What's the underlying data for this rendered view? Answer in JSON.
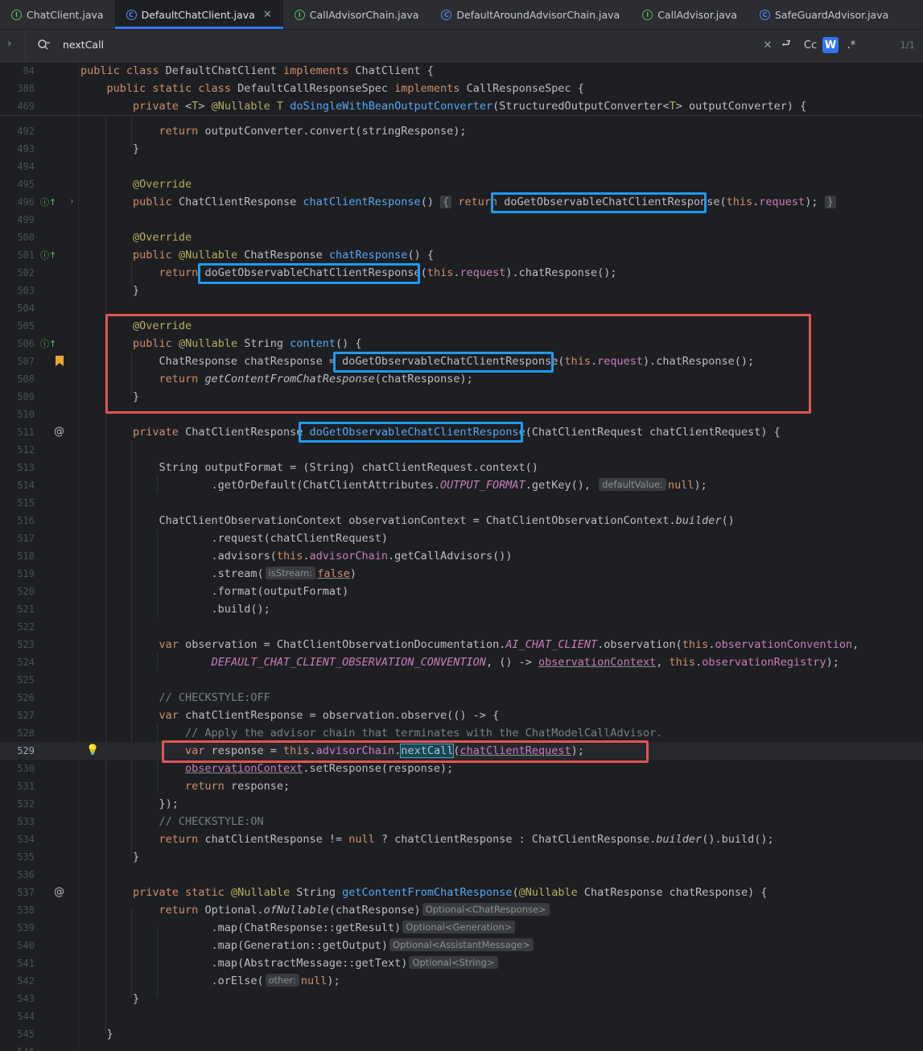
{
  "tabs": [
    {
      "label": "ChatClient.java",
      "kind": "interface",
      "active": false
    },
    {
      "label": "DefaultChatClient.java",
      "kind": "class",
      "active": true
    },
    {
      "label": "CallAdvisorChain.java",
      "kind": "interface",
      "active": false
    },
    {
      "label": "DefaultAroundAdvisorChain.java",
      "kind": "class",
      "active": false
    },
    {
      "label": "CallAdvisor.java",
      "kind": "interface",
      "active": false
    },
    {
      "label": "SafeGuardAdvisor.java",
      "kind": "class",
      "active": false
    }
  ],
  "search": {
    "query": "nextCall",
    "case_label": "Cc",
    "word_label": "W",
    "regex_label": ".*",
    "match_count": "1/1"
  },
  "colors": {
    "background": "#1e1f22",
    "keyword": "#cf8e6d",
    "method": "#56a8f5",
    "annotation": "#b3ae60",
    "field": "#c77dbb",
    "comment": "#7a7e85",
    "highlight_red": "#e05555",
    "highlight_blue": "#1e9bf0"
  },
  "lines": [
    {
      "n": "84",
      "html": "<span class=\"kw\">public class</span> DefaultChatClient <span class=\"kw\">implements</span> ChatClient {"
    },
    {
      "n": "388",
      "html": "    <span class=\"kw\">public static class</span> DefaultCallResponseSpec <span class=\"kw\">implements</span> CallResponseSpec {"
    },
    {
      "n": "469",
      "html": "        <span class=\"kw\">private</span> &lt;<span class=\"ann\">T</span>&gt; <span class=\"ann\">@Nullable</span> <span class=\"ann\">T</span> <span class=\"fn\">doSingleWithBeanOutputConverter</span>(StructuredOutputConverter&lt;<span class=\"ann\">T</span>&gt; outputConverter) {"
    },
    {
      "n": "492",
      "html": "            <span class=\"kw\">return</span> outputConverter.convert(stringResponse);"
    },
    {
      "n": "493",
      "html": "        }"
    },
    {
      "n": "494",
      "html": ""
    },
    {
      "n": "495",
      "html": "        <span class=\"ann\">@Override</span>"
    },
    {
      "n": "496",
      "html": "        <span class=\"kw\">public</span> ChatClientResponse <span class=\"fn\">chatClientResponse</span>() <span class=\"fold\">{</span> <span class=\"kw\">return</span> doGetObservableChatClientResponse(<span class=\"kw\">this</span>.<span class=\"fld\">request</span>); <span class=\"fold\">}</span>"
    },
    {
      "n": "499",
      "html": ""
    },
    {
      "n": "500",
      "html": "        <span class=\"ann\">@Override</span>"
    },
    {
      "n": "501",
      "html": "        <span class=\"kw\">public</span> <span class=\"ann\">@Nullable</span> ChatResponse <span class=\"fn\">chatResponse</span>() {"
    },
    {
      "n": "502",
      "html": "            <span class=\"kw\">return</span> doGetObservableChatClientResponse(<span class=\"kw\">this</span>.<span class=\"fld\">request</span>).chatResponse();"
    },
    {
      "n": "503",
      "html": "        }"
    },
    {
      "n": "504",
      "html": ""
    },
    {
      "n": "505",
      "html": "        <span class=\"ann\">@Override</span>"
    },
    {
      "n": "506",
      "html": "        <span class=\"kw\">public</span> <span class=\"ann\">@Nullable</span> String <span class=\"fn\">content</span>() {"
    },
    {
      "n": "507",
      "html": "            ChatResponse chatResponse = doGetObservableChatClientResponse(<span class=\"kw\">this</span>.<span class=\"fld\">request</span>).chatResponse();"
    },
    {
      "n": "508",
      "html": "            <span class=\"kw\">return</span> <span class=\"it\">getContentFromChatResponse</span>(chatResponse);"
    },
    {
      "n": "509",
      "html": "        }"
    },
    {
      "n": "510",
      "html": ""
    },
    {
      "n": "511",
      "html": "        <span class=\"kw\">private</span> ChatClientResponse <span class=\"fn\">doGetObservableChatClientResponse</span>(ChatClientRequest chatClientRequest) {"
    },
    {
      "n": "512",
      "html": ""
    },
    {
      "n": "513",
      "html": "            String outputFormat = (String) chatClientRequest.context()"
    },
    {
      "n": "514",
      "html": "                    .getOrDefault(ChatClientAttributes.<span class=\"st\">OUTPUT_FORMAT</span>.getKey(), <span class=\"hint\">defaultValue:</span><span class=\"kw\">null</span>);"
    },
    {
      "n": "515",
      "html": ""
    },
    {
      "n": "516",
      "html": "            ChatClientObservationContext observationContext = ChatClientObservationContext.<span class=\"it\">builder</span>()"
    },
    {
      "n": "517",
      "html": "                    .request(chatClientRequest)"
    },
    {
      "n": "518",
      "html": "                    .advisors(<span class=\"kw\">this</span>.<span class=\"fld\">advisorChain</span>.getCallAdvisors())"
    },
    {
      "n": "519",
      "html": "                    .stream(<span class=\"hint\">isStream:</span><span class=\"kw ul\">false</span>)"
    },
    {
      "n": "520",
      "html": "                    .format(outputFormat)"
    },
    {
      "n": "521",
      "html": "                    .build();"
    },
    {
      "n": "522",
      "html": ""
    },
    {
      "n": "523",
      "html": "            <span class=\"kw\">var</span> observation = ChatClientObservationDocumentation.<span class=\"st\">AI_CHAT_CLIENT</span>.observation(<span class=\"kw\">this</span>.<span class=\"fld\">observationConvention</span>,"
    },
    {
      "n": "524",
      "html": "                    <span class=\"st\">DEFAULT_CHAT_CLIENT_OBSERVATION_CONVENTION</span>, () -&gt; <span class=\"fld ul\">observationContext</span>, <span class=\"kw\">this</span>.<span class=\"fld\">observationRegistry</span>);"
    },
    {
      "n": "525",
      "html": ""
    },
    {
      "n": "526",
      "html": "            <span class=\"cm\">// CHECKSTYLE:OFF</span>"
    },
    {
      "n": "527",
      "html": "            <span class=\"kw\">var</span> chatClientResponse = observation.observe(() -&gt; {"
    },
    {
      "n": "528",
      "html": "                <span class=\"cm\">// Apply the advisor chain that terminates with the ChatModelCallAdvisor.</span>"
    },
    {
      "n": "529",
      "html": "                <span class=\"kw\">var</span> response = <span class=\"kw\">this</span>.<span class=\"fld\">advisorChain</span>.<span class=\"match\">nextCall</span>(<span class=\"fld ul\">chatClientRequest</span>);"
    },
    {
      "n": "530",
      "html": "                <span class=\"fld ul\">observationContext</span>.setResponse(response);"
    },
    {
      "n": "531",
      "html": "                <span class=\"kw\">return</span> response;"
    },
    {
      "n": "532",
      "html": "            });"
    },
    {
      "n": "533",
      "html": "            <span class=\"cm\">// CHECKSTYLE:ON</span>"
    },
    {
      "n": "534",
      "html": "            <span class=\"kw\">return</span> chatClientResponse != <span class=\"kw\">null</span> ? chatClientResponse : ChatClientResponse.<span class=\"it\">builder</span>().build();"
    },
    {
      "n": "535",
      "html": "        }"
    },
    {
      "n": "536",
      "html": ""
    },
    {
      "n": "537",
      "html": "        <span class=\"kw\">private static</span> <span class=\"ann\">@Nullable</span> String <span class=\"fn\">getContentFromChatResponse</span>(<span class=\"ann\">@Nullable</span> ChatResponse chatResponse) {"
    },
    {
      "n": "538",
      "html": "            <span class=\"kw\">return</span> Optional.<span class=\"it\">ofNullable</span>(chatResponse)<span class=\"hint\">Optional&lt;ChatResponse&gt;</span>"
    },
    {
      "n": "539",
      "html": "                    .map(ChatResponse::getResult)<span class=\"hint\">Optional&lt;Generation&gt;</span>"
    },
    {
      "n": "540",
      "html": "                    .map(Generation::getOutput)<span class=\"hint\">Optional&lt;AssistantMessage&gt;</span>"
    },
    {
      "n": "541",
      "html": "                    .map(AbstractMessage::getText)<span class=\"hint\">Optional&lt;String&gt;</span>"
    },
    {
      "n": "542",
      "html": "                    .orElse(<span class=\"hint\">other:</span><span class=\"kw\">null</span>);"
    },
    {
      "n": "543",
      "html": "        }"
    },
    {
      "n": "544",
      "html": ""
    },
    {
      "n": "545",
      "html": "    }"
    },
    {
      "n": "546",
      "html": ""
    }
  ]
}
